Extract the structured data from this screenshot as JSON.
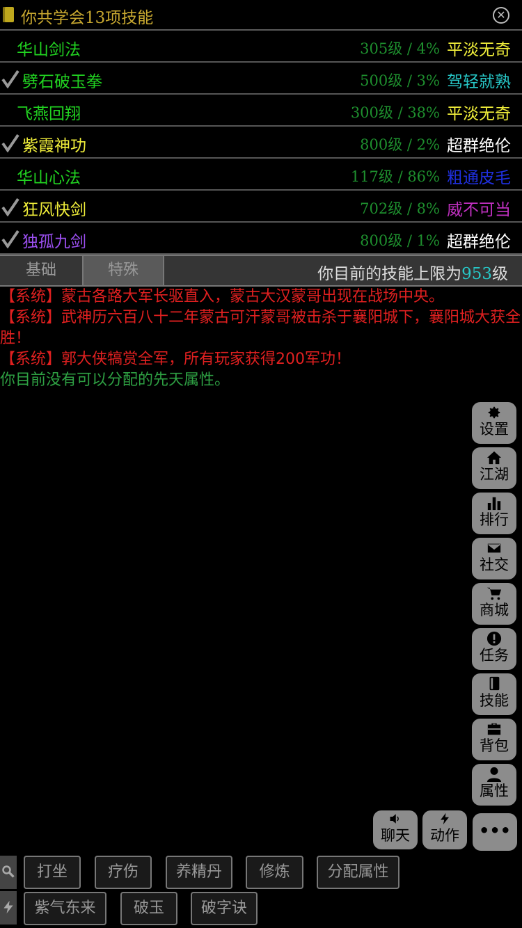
{
  "header": {
    "title": "你共学会13项技能",
    "icons": [
      "book-icon",
      "close-icon"
    ]
  },
  "skills": [
    {
      "name": "华山剑法",
      "name_color": "#21d321",
      "checked": false,
      "level": "305级 / 4%",
      "grade": "平淡无奇",
      "grade_color": "#f0ee3a"
    },
    {
      "name": "劈石破玉拳",
      "name_color": "#21d321",
      "checked": true,
      "level": "500级 / 3%",
      "grade": "驾轻就熟",
      "grade_color": "#27c7c7"
    },
    {
      "name": "飞燕回翔",
      "name_color": "#21d321",
      "checked": false,
      "level": "300级 / 38%",
      "grade": "平淡无奇",
      "grade_color": "#f0ee3a"
    },
    {
      "name": "紫霞神功",
      "name_color": "#f0ee3a",
      "checked": true,
      "level": "800级 / 2%",
      "grade": "超群绝伦",
      "grade_color": "#ffffff"
    },
    {
      "name": "华山心法",
      "name_color": "#21d321",
      "checked": false,
      "level": "117级 / 86%",
      "grade": "粗通皮毛",
      "grade_color": "#1f30e0"
    },
    {
      "name": "狂风快剑",
      "name_color": "#f0ee3a",
      "checked": true,
      "level": "702级 / 8%",
      "grade": "威不可当",
      "grade_color": "#c030c0"
    },
    {
      "name": "独孤九剑",
      "name_color": "#9b4ff0",
      "checked": true,
      "level": "800级 / 1%",
      "grade": "超群绝伦",
      "grade_color": "#ffffff"
    }
  ],
  "tabs": {
    "base": "基础",
    "special": "特殊"
  },
  "limit": {
    "prefix": "你目前的技能上限为",
    "value": "953",
    "suffix": "级"
  },
  "log": [
    {
      "text": "【系统】蒙古各路大军长驱直入，蒙古大汉蒙哥出现在战场中央。",
      "type": "sys"
    },
    {
      "text": "【系统】武神历六百八十二年蒙古可汗蒙哥被击杀于襄阳城下，襄阳城大获全胜！",
      "type": "sys"
    },
    {
      "text": "【系统】郭大侠犒赏全军，所有玩家获得200军功！",
      "type": "sys"
    },
    {
      "text": "你目前没有可以分配的先天属性。",
      "type": "info"
    }
  ],
  "side_menu": [
    {
      "label": "设置",
      "icon": "gear-icon"
    },
    {
      "label": "江湖",
      "icon": "home-icon"
    },
    {
      "label": "排行",
      "icon": "bar-chart-icon"
    },
    {
      "label": "社交",
      "icon": "envelope-icon"
    },
    {
      "label": "商城",
      "icon": "cart-icon"
    },
    {
      "label": "任务",
      "icon": "exclamation-icon"
    },
    {
      "label": "技能",
      "icon": "book-icon"
    },
    {
      "label": "背包",
      "icon": "briefcase-icon"
    },
    {
      "label": "属性",
      "icon": "user-icon"
    }
  ],
  "bottom_menu": [
    {
      "label": "聊天",
      "icon": "speaker-icon"
    },
    {
      "label": "动作",
      "icon": "lightning-icon"
    },
    {
      "label": "•••",
      "icon": "more-icon"
    }
  ],
  "actions_row1": [
    "打坐",
    "疗伤",
    "养精丹",
    "修炼",
    "分配属性"
  ],
  "actions_row2": [
    "紫气东来",
    "破玉",
    "破字诀"
  ]
}
